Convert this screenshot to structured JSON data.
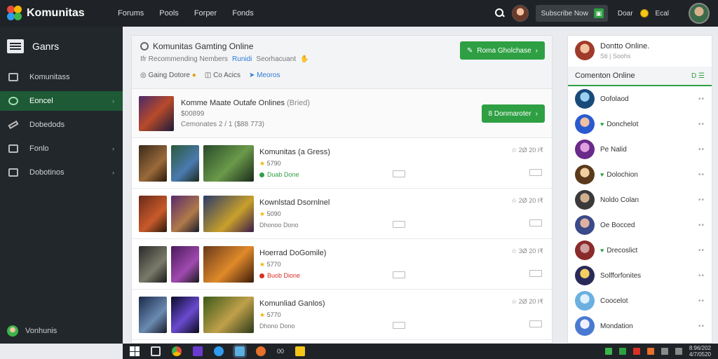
{
  "app": {
    "name": "Komunitas"
  },
  "topnav": [
    "Forums",
    "Pools",
    "Forper",
    "Fonds"
  ],
  "user": {
    "label": "Subscribe Now",
    "mode_label": "Doar",
    "coins_label": "Ecal"
  },
  "sidebar": {
    "title": "Ganrs",
    "items": [
      {
        "label": "Komunitass",
        "icon": "book-icon",
        "chevron": ""
      },
      {
        "label": "Eoncel",
        "icon": "gamepad-icon",
        "chevron": "›",
        "active": true
      },
      {
        "label": "Dobedods",
        "icon": "pin-icon",
        "chevron": ""
      },
      {
        "label": "Fonlo",
        "icon": "table-icon",
        "chevron": "›"
      },
      {
        "label": "Dobotinos",
        "icon": "stack-icon",
        "chevron": "›"
      }
    ],
    "footer": "Vonhunis"
  },
  "main": {
    "header": {
      "title": "Komunitas Gamting Online",
      "sub_prefix": "Ifr Recommending Nembers",
      "sub_highlight": "Runidi",
      "sub_suffix": "Seorhacuant",
      "tag1": "Gaing Dotore",
      "tag2": "Co Acics",
      "tag3": "Meoros",
      "button": "Roma Gholchase"
    },
    "feature": {
      "title": "Komme Maate Outafe Onlines",
      "note": "(Bried)",
      "line1": "$00899",
      "line2": "Cemonates 2 / 1 ($88 773)",
      "button": "8 Donmaroter"
    },
    "rows": [
      {
        "title": "Komunitas (a Gress)",
        "rating": "5790",
        "status": "Duab Done",
        "status_color": "#2ea043",
        "meta": "☆ 2Ø  20  I₹"
      },
      {
        "title": "Kownlstad Dsornlnel",
        "rating": "5090",
        "status": "Dhonoo Dono",
        "status_color": "#888888",
        "meta": "☆ 2Ø  20  I₹"
      },
      {
        "title": "Hoerrad DoGomile)",
        "rating": "5770",
        "status": "Buob Dione",
        "status_color": "#d93025",
        "meta": "☆ 3Ø  20  I₹"
      },
      {
        "title": "Komunliad Ganlos)",
        "rating": "5770",
        "status": "Dhono Dono",
        "status_color": "#888888",
        "meta": "☆ 2Ø  20  I₹"
      }
    ]
  },
  "right_panel": {
    "head_title": "Dontto Online.",
    "head_sub": "Sti | Soohs",
    "section_title": "Comenton Online",
    "section_right": "D ☰",
    "friends": [
      {
        "name": "Oofolaod",
        "heart": false
      },
      {
        "name": "Donchelot",
        "heart": true
      },
      {
        "name": "Pe Nalid",
        "heart": false
      },
      {
        "name": "Dolochion",
        "heart": true
      },
      {
        "name": "Noldo Colan",
        "heart": false
      },
      {
        "name": "Oe Bocced",
        "heart": false
      },
      {
        "name": "Drecoslict",
        "heart": true
      },
      {
        "name": "Solfforfonites",
        "heart": false
      },
      {
        "name": "Coocelot",
        "heart": false
      },
      {
        "name": "Mondation",
        "heart": false
      }
    ]
  },
  "taskbar": {
    "item_text": "00",
    "clock_line1": "8:96/202",
    "clock_line2": "4/7/0520"
  },
  "colors": {
    "accent": "#2ea043",
    "topbar": "#1f2327",
    "sidebar": "#22272b"
  }
}
